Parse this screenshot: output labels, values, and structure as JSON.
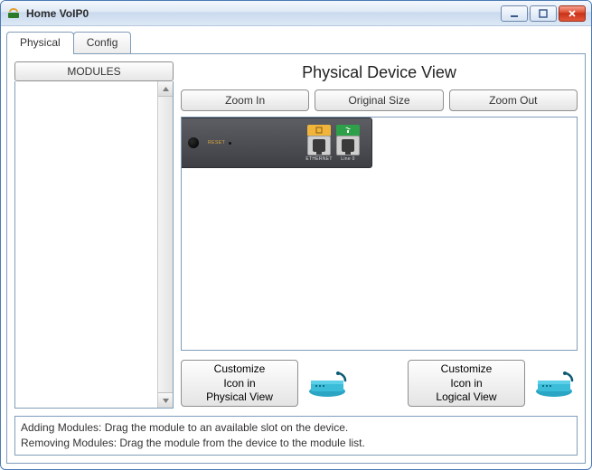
{
  "window": {
    "title": "Home VoIP0"
  },
  "tabs": [
    {
      "label": "Physical",
      "active": true
    },
    {
      "label": "Config",
      "active": false
    }
  ],
  "modules": {
    "header": "MODULES"
  },
  "physical": {
    "title": "Physical Device View",
    "zoom_in": "Zoom In",
    "original_size": "Original Size",
    "zoom_out": "Zoom Out",
    "device": {
      "reset_label": "RESET",
      "ports": [
        {
          "top_color": "#f0b53a",
          "label": "ETHERNET"
        },
        {
          "top_color": "#2ea04a",
          "label": "Line 0"
        }
      ]
    },
    "customize_physical": "Customize\nIcon in\nPhysical View",
    "customize_logical": "Customize\nIcon in\nLogical View"
  },
  "help": {
    "line1": "Adding Modules: Drag the module to an available slot on the device.",
    "line2": "Removing Modules: Drag the module from the device to the module list."
  }
}
